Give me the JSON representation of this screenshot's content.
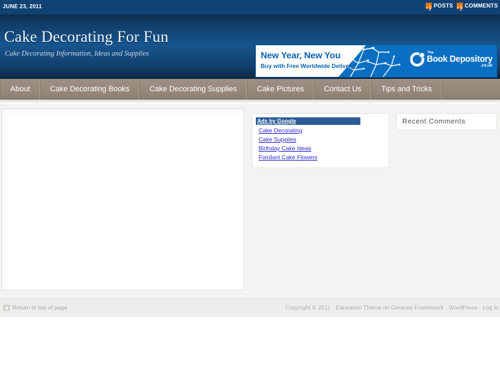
{
  "topbar": {
    "date": "JUNE 23, 2011",
    "feeds": [
      {
        "label": "POSTS",
        "icon": "rss-icon"
      },
      {
        "label": "COMMENTS",
        "icon": "rss-icon"
      }
    ],
    "background": "#104273"
  },
  "header": {
    "site_title": "Cake Decorating For Fun",
    "site_description": "Cake Decorating Information, Ideas and Supplies",
    "background_top": "#0d2d4e",
    "background_mid": "#17558e"
  },
  "banner_ad": {
    "headline": "New Year, New You",
    "subline": "Buy with Free Worldwide Delivery",
    "brand_the": "The",
    "brand_name": "Book Depository",
    "brand_tld": ".co.uk",
    "background": "#0a6fc2",
    "text_color": "#0b63b2"
  },
  "nav": {
    "items": [
      {
        "label": "About"
      },
      {
        "label": "Cake Decorating Books"
      },
      {
        "label": "Cake Decorating Supplies"
      },
      {
        "label": "Cake Pictures"
      },
      {
        "label": "Contact Us"
      },
      {
        "label": "Tips and Tricks"
      }
    ],
    "background": "#97897c"
  },
  "ads_box": {
    "header_label": "Ads by Google",
    "header_background": "#2b5c96",
    "link_color": "#2b2bd0",
    "links": [
      {
        "label": "Cake Decorating"
      },
      {
        "label": "Cake Supplies"
      },
      {
        "label": "Birthday Cake Ideas"
      },
      {
        "label": "Fondant Cake Flowers"
      }
    ]
  },
  "sidebar": {
    "widgets": [
      {
        "title": "Recent Comments"
      }
    ]
  },
  "footer": {
    "return_top_label": "Return to top of page",
    "credits": "Copyright © 2011 · Education Theme on Genesis Framework · WordPress · Log in",
    "background": "#eeeeee"
  }
}
